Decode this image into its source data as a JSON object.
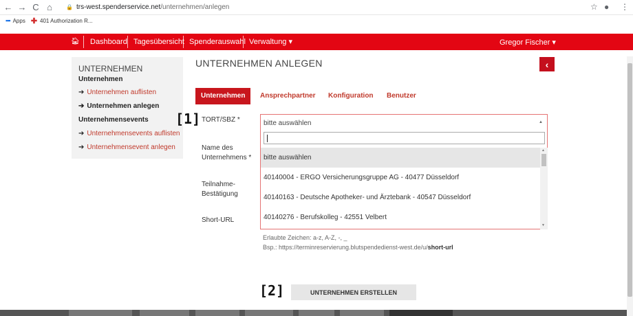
{
  "browser": {
    "url_host": "trs-west.spenderservice.net",
    "url_path": "/unternehmen/anlegen",
    "bookmarks": [
      {
        "label": "Apps",
        "icon": "apps-grid-icon"
      },
      {
        "label": "401 Authorization R...",
        "icon": "red-cross-icon"
      }
    ]
  },
  "topnav": {
    "home_icon": "home-icon",
    "items": [
      "Dashboard",
      "Tagesübersicht",
      "Spenderauswahl",
      "Verwaltung ▾"
    ],
    "user": "Gregor Fischer ▾"
  },
  "sidebar": {
    "title": "UNTERNEHMEN",
    "section1": "Unternehmen",
    "links1": [
      "Unternehmen auflisten",
      "Unternehmen anlegen"
    ],
    "section2": "Unternehmensevents",
    "links2": [
      "Unternehmensevents auflisten",
      "Unternehmensevent anlegen"
    ]
  },
  "page": {
    "title": "UNTERNEHMEN ANLEGEN",
    "back_icon": "chevron-left-icon",
    "tabs": [
      "Unternehmen",
      "Ansprechpartner",
      "Konfiguration",
      "Benutzer"
    ]
  },
  "form": {
    "tort_label": "TORT/SBZ *",
    "name_label_l1": "Name des",
    "name_label_l2": "Unternehmens *",
    "teilnahme_l1": "Teilnahme-",
    "teilnahme_l2": "Bestätigung",
    "shorturl_label": "Short-URL",
    "select_value": "bitte auswählen",
    "options": [
      "bitte auswählen",
      "40140004 - ERGO Versicherungsgruppe AG - 40477 Düsseldorf",
      "40140163 - Deutsche Apotheker- und Ärztebank - 40547 Düsseldorf",
      "40140276 - Berufskolleg - 42551 Velbert"
    ],
    "help_line1": "Erlaubte Zeichen: a-z, A-Z, -, _",
    "help_line2_prefix": "Bsp.: https://terminreservierung.blutspendedienst-west.de/u/",
    "help_line2_bold": "short-url",
    "submit_label": "UNTERNEHMEN ERSTELLEN"
  },
  "markers": {
    "m1": "[1]",
    "m2": "[2]"
  }
}
